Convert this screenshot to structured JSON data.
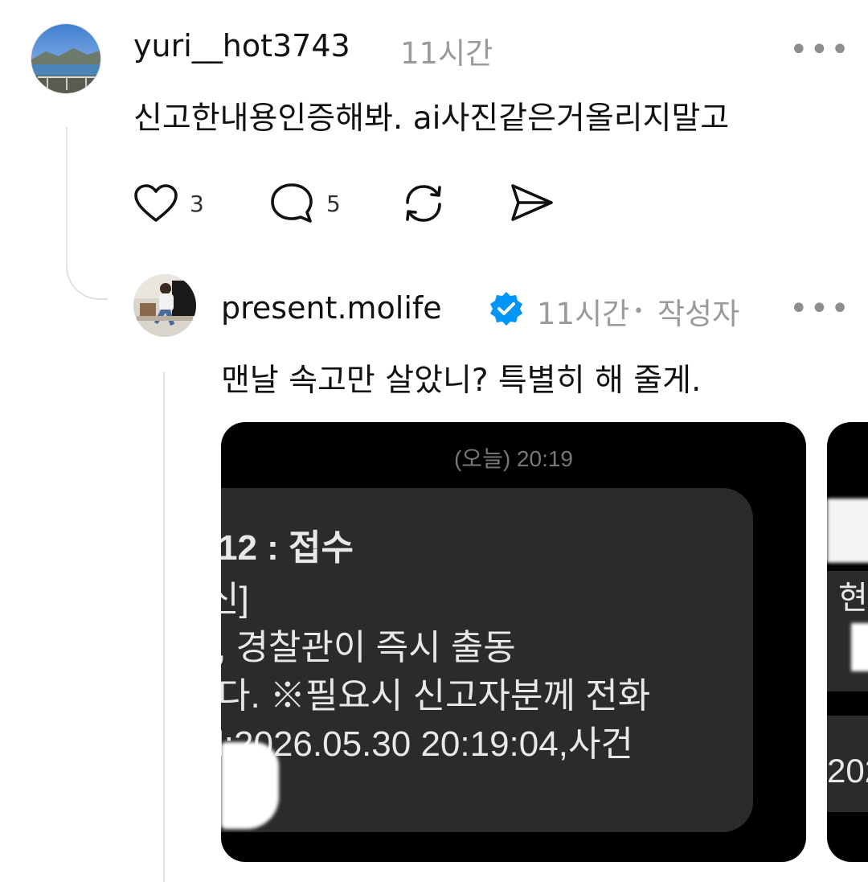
{
  "post": {
    "username": "yuri__hot3743",
    "time": "11시간",
    "text": "신고한내용인증해봐. ai사진같은거올리지말고",
    "likes": "3",
    "replies": "5"
  },
  "reply": {
    "username": "present.molife",
    "time": "11시간",
    "separator": "•",
    "author_badge": "작성자",
    "text": "맨날 속고만 살았니? 특별히 해 줄게."
  },
  "image": {
    "timestamp": "(오늘) 20:19",
    "lines": [
      "12 : 접수",
      "신]",
      ", 경찰관이 즉시 출동",
      "다. ※필요시 신고자분께 전화",
      "l:2026.05.30 20:19:04,사건"
    ],
    "peek_lines": [
      "현",
      "202"
    ]
  },
  "more_label": "•••",
  "colors": {
    "verified": "#0095f6",
    "line": "#e2e2e2",
    "meta": "#9a9a9a"
  }
}
